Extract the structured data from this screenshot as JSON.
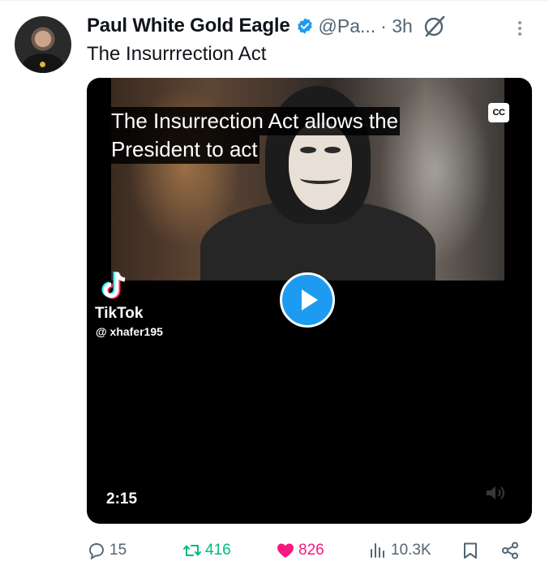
{
  "tweet": {
    "author_name": "Paul White Gold Eagle",
    "handle": "@Pa...",
    "time": "· 3h",
    "text": "The Insurrrection Act",
    "verified_icon": "verified-badge-icon",
    "grok_icon": "grok-icon",
    "more_icon": "more-options-icon"
  },
  "media": {
    "caption_line1": "The Insurrection Act allows the",
    "caption_line2": "President to act",
    "cc_label": "CC",
    "watermark_brand": "TikTok",
    "watermark_user": "@ xhafer195",
    "duration": "2:15",
    "play_icon": "play-icon",
    "volume_icon": "volume-muted-icon"
  },
  "actions": {
    "replies": "15",
    "retweets": "416",
    "likes": "826",
    "views": "10.3K",
    "reply_icon": "reply-icon",
    "retweet_icon": "retweet-icon",
    "like_icon": "heart-icon",
    "views_icon": "views-icon",
    "bookmark_icon": "bookmark-icon",
    "share_icon": "share-icon"
  },
  "colors": {
    "blue": "#1d9bf0",
    "green": "#00ba7c",
    "pink": "#f91880",
    "gray": "#536471"
  }
}
